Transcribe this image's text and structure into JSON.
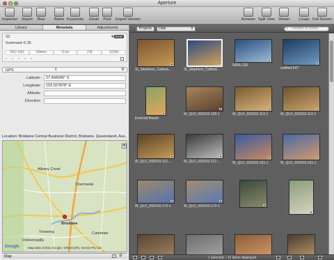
{
  "window": {
    "title": "Aperture"
  },
  "toolbar": {
    "left": [
      {
        "label": "Inspector",
        "icon": "inspector-icon"
      },
      {
        "label": "Import",
        "icon": "import-icon"
      },
      {
        "label": "New",
        "icon": "new-icon"
      },
      {
        "label": "Name",
        "icon": "name-icon"
      },
      {
        "label": "Keywords",
        "icon": "keywords-icon"
      },
      {
        "label": "Email",
        "icon": "email-icon"
      },
      {
        "label": "Print",
        "icon": "print-icon"
      },
      {
        "label": "Export Version",
        "icon": "export-icon"
      }
    ],
    "right": [
      {
        "label": "Browser",
        "icon": "browser-icon"
      },
      {
        "label": "Split View",
        "icon": "split-view-icon"
      },
      {
        "label": "Viewer",
        "icon": "viewer-icon"
      },
      {
        "label": "Loupe",
        "icon": "loupe-icon"
      },
      {
        "label": "Full Screen",
        "icon": "full-screen-icon"
      }
    ]
  },
  "tabs": [
    "Library",
    "Metadata",
    "Adjustments"
  ],
  "metadata": {
    "camera": "S2",
    "lens": "Summarit-S 35",
    "raw_badge": "RAW",
    "exif": [
      "ISO 160",
      "35mm",
      "0 ev",
      "ƒ/8",
      "1/250"
    ],
    "rating_dots": "• • • • •"
  },
  "gps": {
    "selector": "GPS",
    "fields": [
      {
        "label": "Latitude:",
        "value": "27.466546° S"
      },
      {
        "label": "Longitude:",
        "value": "153.027878° E"
      },
      {
        "label": "Altitude:",
        "value": ""
      },
      {
        "label": "Direction:",
        "value": ""
      }
    ]
  },
  "location": "Location:  Brisbane Central Business District, Brisbane, Queensland, Aus...",
  "map": {
    "labels": [
      "Brisbane",
      "Toowong",
      "Indooroopilly",
      "Carindale",
      "Albany Creek",
      "Chermside"
    ],
    "google": "Google",
    "copyright": "Map data ©2011 Google, Whereis(R), Sensis Pty Ltd",
    "footer_label": "Map"
  },
  "browser": {
    "projects_button": "Projects",
    "sort": "Date",
    "filter_placeholder": "Unrated or Better",
    "status": "1 selected – 11 items displayed",
    "thumbs": [
      {
        "caption": "St_Stephens_Cathed...",
        "colors": [
          "#7a5430",
          "#c79a55"
        ],
        "selected": false
      },
      {
        "caption": "St_Stephens_Cathed...",
        "colors": [
          "#2d4a80",
          "#d4a35a"
        ],
        "selected": true
      },
      {
        "caption": "NIRA-128",
        "colors": [
          "#2a4f7e",
          "#9dbbd6"
        ],
        "selected": false
      },
      {
        "caption": "untitled-647",
        "colors": [
          "#1f3a5c",
          "#6f9cc4"
        ],
        "selected": false
      },
      {
        "caption": "Emerald Beach",
        "colors": [
          "#8aa26b",
          "#e0a85a"
        ],
        "selected": false
      },
      {
        "caption": "W_QLD_092010-100-1",
        "colors": [
          "#a6845a",
          "#5b4230"
        ],
        "selected": false
      },
      {
        "caption": "W_QLD_092010-113-1",
        "colors": [
          "#7a5a33",
          "#d8b47a"
        ],
        "selected": false
      },
      {
        "caption": "W_QLD_092010-112-1",
        "colors": [
          "#6e5230",
          "#caa56a"
        ],
        "selected": false
      },
      {
        "caption": "W_QLD_092010-112-...",
        "colors": [
          "#5a4428",
          "#c89a58"
        ],
        "selected": false
      },
      {
        "caption": "W_QLD_092010-112-...",
        "colors": [
          "#3a3a3a",
          "#bdbdbd"
        ],
        "selected": false
      },
      {
        "caption": "W_QLD_092010-161-1",
        "colors": [
          "#3b5b9e",
          "#c98a62"
        ],
        "selected": false
      },
      {
        "caption": "W_QLD_092010-161-1",
        "colors": [
          "#4b6aa6",
          "#d29a6a"
        ],
        "selected": false
      },
      {
        "caption": "W_QLD_092010-172-1",
        "colors": [
          "#9c8a6c",
          "#5673b0"
        ],
        "selected": false
      },
      {
        "caption": "W_QLD_092010-172-1",
        "colors": [
          "#a48e6e",
          "#5a79b5"
        ],
        "selected": false
      },
      {
        "caption": "",
        "colors": [
          "#3a4a3a",
          "#8a8a6a"
        ],
        "selected": false
      },
      {
        "caption": "",
        "colors": [
          "#8b9e7a",
          "#d8d2c0"
        ],
        "selected": false
      },
      {
        "caption": "",
        "colors": [
          "#5a4530",
          "#a58a6a"
        ],
        "selected": false
      },
      {
        "caption": "",
        "colors": [
          "#6e6e6e",
          "#aaaaaa"
        ],
        "selected": false
      },
      {
        "caption": "",
        "colors": [
          "#8a5e3a",
          "#d8a070"
        ],
        "selected": false
      },
      {
        "caption": "",
        "colors": [
          "#4a3e30",
          "#c4a070"
        ],
        "selected": false
      }
    ]
  }
}
